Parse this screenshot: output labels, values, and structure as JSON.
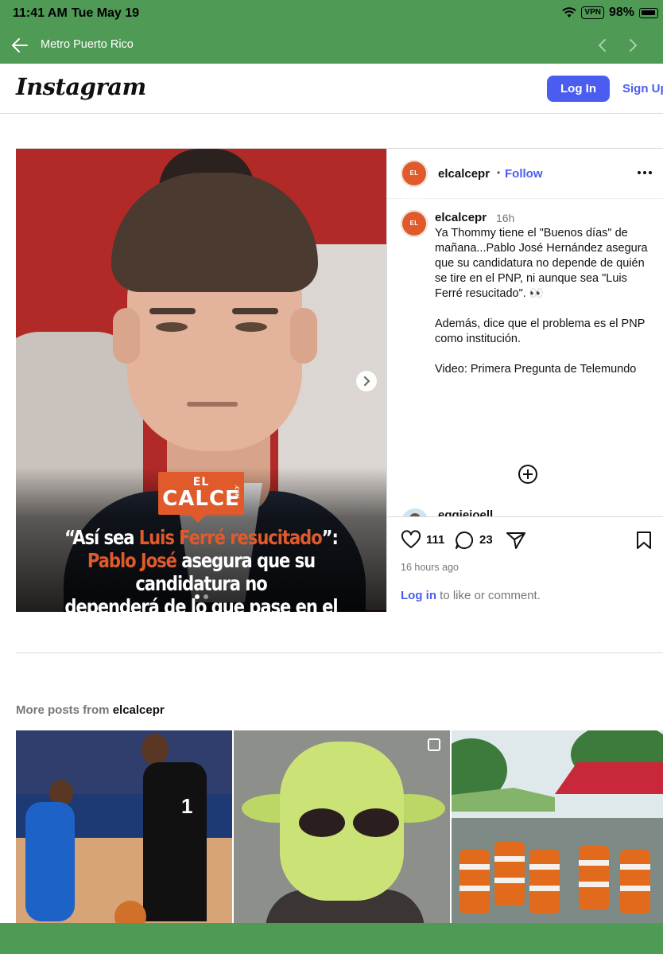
{
  "status_bar": {
    "time": "11:41 AM",
    "date": "Tue May 19",
    "vpn": "VPN",
    "battery": "98%",
    "icons": [
      "wifi-icon",
      "battery-icon"
    ]
  },
  "browser": {
    "site_name": "Metro Puerto Rico",
    "color": "#4f9a55"
  },
  "instagram_header": {
    "logo": "Instagram",
    "login_label": "Log In",
    "signup_label": "Sign Up"
  },
  "post": {
    "author": "elcalcepr",
    "author_avatar_text": "EL CALCE",
    "separator": "•",
    "follow_label": "Follow",
    "caption_author": "elcalcepr",
    "caption_time": "16h",
    "caption_paragraphs": [
      "Ya Thommy tiene el \"Buenos días\" de mañana...Pablo José Hernández asegura que su candidatura no depende de quién se tire en el PNP, ni aunque sea \"Luis Ferré resucitado\". 👀",
      "Además, dice que el problema es el PNP como institución.",
      "Video: Primera Pregunta de Telemundo"
    ],
    "commenter": "eggiejoell",
    "likes": "111",
    "comments": "23",
    "posted_ago": "16 hours ago",
    "login_link": "Log in",
    "login_suffix": " to like or comment."
  },
  "media": {
    "badge_line1": "EL",
    "badge_line2": "CALCE",
    "badge_dotcom": ".COM",
    "headline_quote_open": "“Así sea ",
    "headline_highlight1": "Luis Ferré resucitado",
    "headline_quote_close": "”:",
    "headline_highlight2": "Pablo José",
    "headline_rest1": " asegura que su candidatura no",
    "headline_rest2": "dependerá de lo que pase en el PNP",
    "accent_color": "#e05a2b",
    "thumb2_jersey_number": "1"
  },
  "more_posts": {
    "prefix": "More posts from ",
    "account": "elcalcepr"
  }
}
